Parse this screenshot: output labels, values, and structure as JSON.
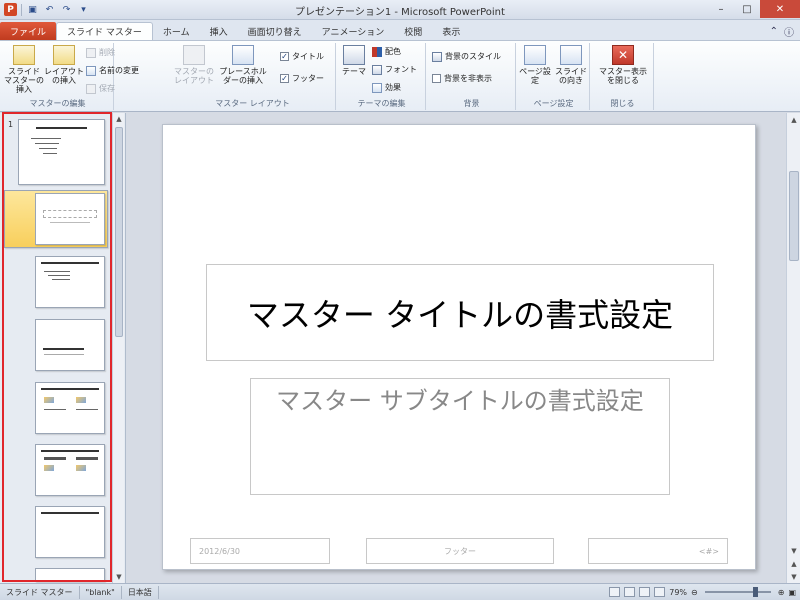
{
  "app": {
    "title": "プレゼンテーション1 - Microsoft PowerPoint",
    "qat_label": "P"
  },
  "tabs": [
    "ファイル",
    "スライド マスター",
    "ホーム",
    "挿入",
    "画面切り替え",
    "アニメーション",
    "校閲",
    "表示"
  ],
  "ribbon": {
    "edit_master": {
      "label": "マスターの編集",
      "insert_master": "スライド マスターの挿入",
      "insert_layout": "レイアウトの挿入",
      "delete": "削除",
      "rename": "名前の変更",
      "preserve": "保存"
    },
    "master_layout": {
      "label": "マスター レイアウト",
      "master_layout_btn": "マスターのレイアウト",
      "insert_placeholder": "プレースホルダーの挿入",
      "title_cb": "タイトル",
      "footer_cb": "フッター"
    },
    "edit_theme": {
      "label": "テーマの編集",
      "themes": "テーマ",
      "colors": "配色",
      "fonts": "フォント",
      "effects": "効果"
    },
    "background": {
      "label": "背景",
      "styles": "背景のスタイル",
      "hide": "背景を非表示"
    },
    "page_setup": {
      "label": "ページ設定",
      "page_setup_btn": "ページ設定",
      "orientation": "スライドの向き"
    },
    "close": {
      "label": "閉じる",
      "close_master": "マスター表示を閉じる"
    }
  },
  "thumbnails": {
    "first_number": "1"
  },
  "slide": {
    "title": "マスター タイトルの書式設定",
    "subtitle": "マスター サブタイトルの書式設定",
    "date": "2012/6/30",
    "footer": "フッター",
    "number": "<#>"
  },
  "status": {
    "view": "スライド マスター",
    "theme": "\"blank\"",
    "language": "日本語",
    "zoom": "79%"
  }
}
